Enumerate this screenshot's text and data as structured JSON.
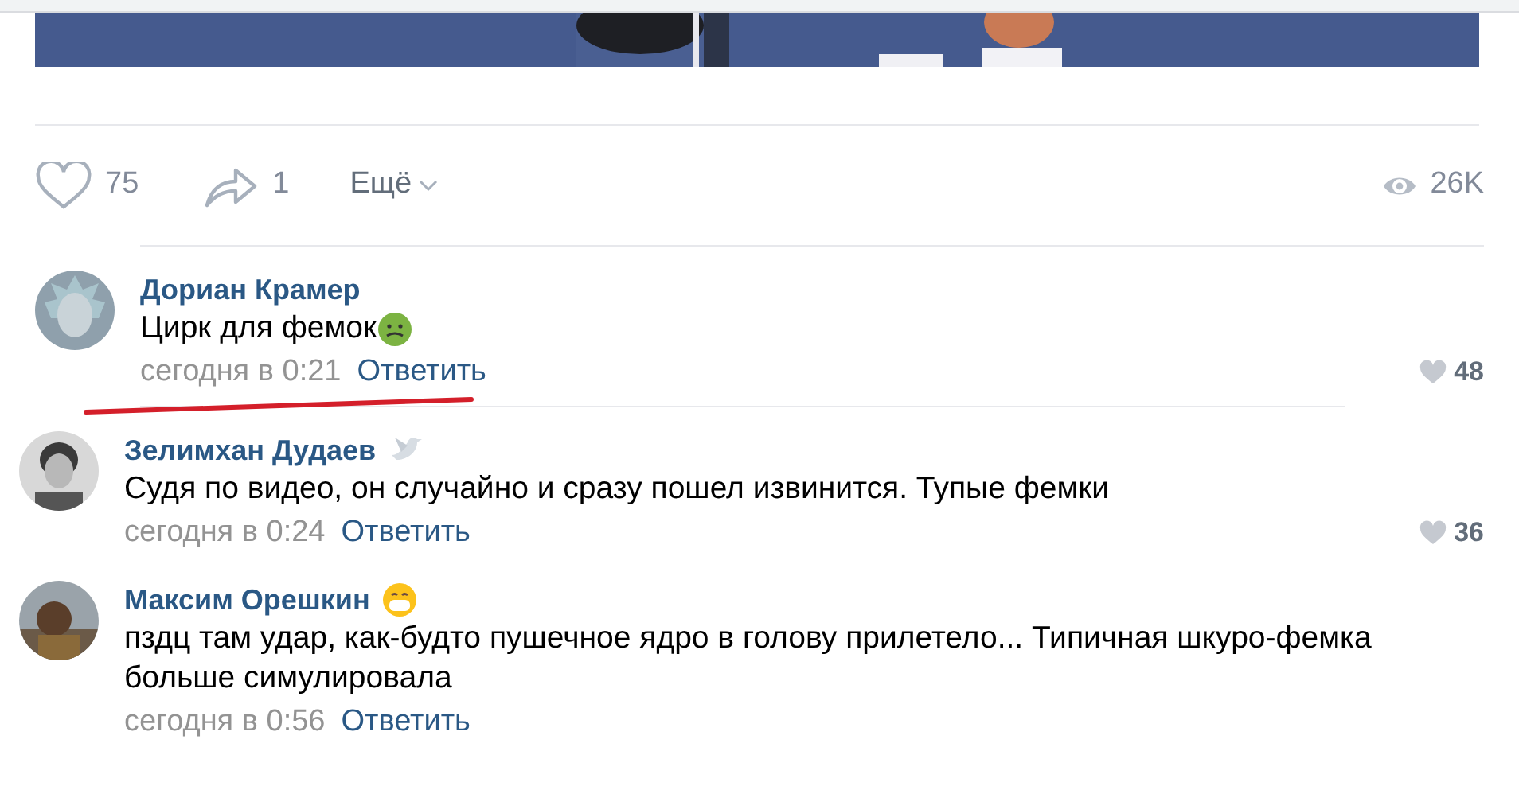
{
  "post_actions": {
    "likes": "75",
    "shares": "1",
    "more": "Ещё",
    "views": "26K"
  },
  "comments": [
    {
      "author": "Дориан Крамер",
      "text": "Цирк для фемок",
      "time": "сегодня в 0:21",
      "reply": "Ответить",
      "likes": "48"
    },
    {
      "author": "Зелимхан Дудаев",
      "text": "Судя по видео, он случайно и сразу пошел извинится. Тупые фемки",
      "time": "сегодня в 0:24",
      "reply": "Ответить",
      "likes": "36"
    },
    {
      "author": "Максим Орешкин",
      "text": "пздц там удар, как-будто пушечное ядро в голову прилетело... Типичная шкуро-фемка больше симулировала",
      "time": "сегодня в 0:56",
      "reply": "Ответить"
    }
  ]
}
